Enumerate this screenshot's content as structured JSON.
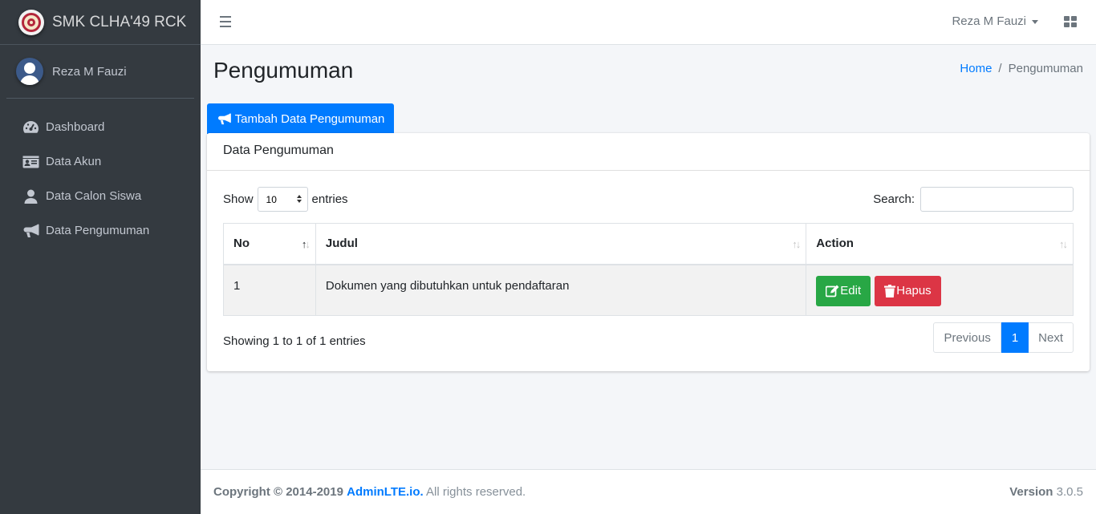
{
  "brand": {
    "name": "SMK CLHA'49 RCK"
  },
  "user": {
    "name": "Reza M Fauzi"
  },
  "sidebar": {
    "items": [
      {
        "label": "Dashboard",
        "icon": "tachometer-icon"
      },
      {
        "label": "Data Akun",
        "icon": "id-card-icon"
      },
      {
        "label": "Data Calon Siswa",
        "icon": "user-icon"
      },
      {
        "label": "Data Pengumuman",
        "icon": "bullhorn-icon"
      }
    ]
  },
  "header": {
    "user_label": "Reza M Fauzi"
  },
  "page": {
    "title": "Pengumuman",
    "breadcrumb": {
      "home": "Home",
      "separator": "/",
      "current": "Pengumuman"
    },
    "add_button": "Tambah Data Pengumuman"
  },
  "card": {
    "title": "Data Pengumuman",
    "length": {
      "show": "Show",
      "value": "10",
      "entries": "entries"
    },
    "search_label": "Search:",
    "table": {
      "columns": [
        "No",
        "Judul",
        "Action"
      ],
      "rows": [
        {
          "no": "1",
          "judul": "Dokumen yang dibutuhkan untuk pendaftaran",
          "edit": "Edit",
          "hapus": "Hapus"
        }
      ]
    },
    "info": "Showing 1 to 1 of 1 entries",
    "pagination": {
      "previous": "Previous",
      "current": "1",
      "next": "Next"
    }
  },
  "footer": {
    "copyright_prefix": "Copyright © 2014-2019",
    "link": "AdminLTE.io.",
    "suffix": "All rights reserved.",
    "version_label": "Version",
    "version": "3.0.5"
  },
  "colors": {
    "primary": "#007bff",
    "success": "#28a745",
    "danger": "#dc3545",
    "sidebar": "#343a40"
  }
}
